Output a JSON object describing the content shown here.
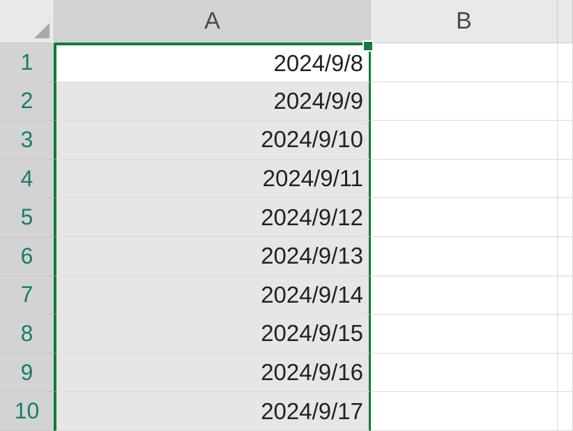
{
  "columns": [
    "A",
    "B",
    ""
  ],
  "rows": [
    "1",
    "2",
    "3",
    "4",
    "5",
    "6",
    "7",
    "8",
    "9",
    "10"
  ],
  "cells": {
    "A": [
      "2024/9/8",
      "2024/9/9",
      "2024/9/10",
      "2024/9/11",
      "2024/9/12",
      "2024/9/13",
      "2024/9/14",
      "2024/9/15",
      "2024/9/16",
      "2024/9/17"
    ],
    "B": [
      "",
      "",
      "",
      "",
      "",
      "",
      "",
      "",
      "",
      ""
    ],
    "C": [
      "",
      "",
      "",
      "",
      "",
      "",
      "",
      "",
      "",
      ""
    ]
  },
  "selection": {
    "range": "A1:A10",
    "active": "A1"
  },
  "chart_data": {
    "type": "table",
    "columns": [
      "A"
    ],
    "rows": [
      [
        "2024/9/8"
      ],
      [
        "2024/9/9"
      ],
      [
        "2024/9/10"
      ],
      [
        "2024/9/11"
      ],
      [
        "2024/9/12"
      ],
      [
        "2024/9/13"
      ],
      [
        "2024/9/14"
      ],
      [
        "2024/9/15"
      ],
      [
        "2024/9/16"
      ],
      [
        "2024/9/17"
      ]
    ]
  }
}
